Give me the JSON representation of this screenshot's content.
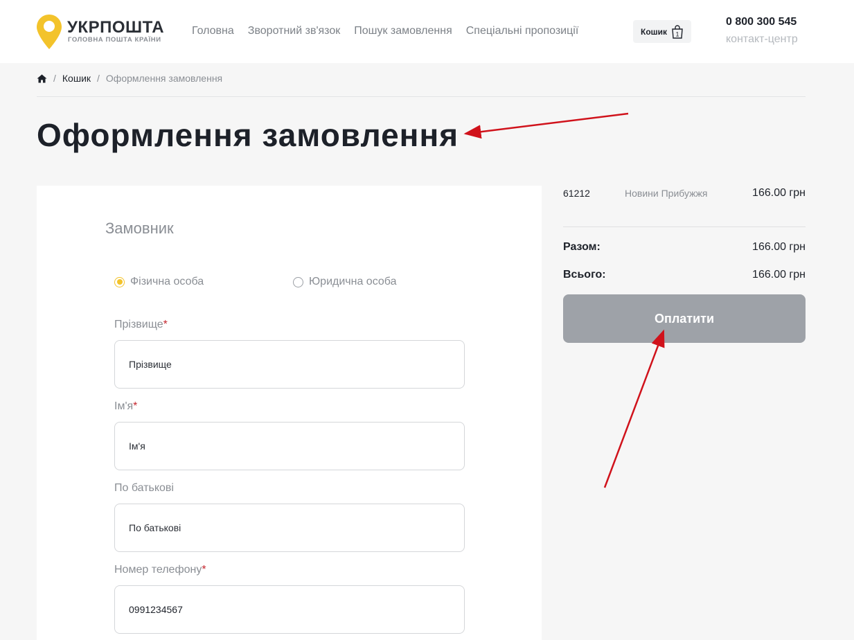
{
  "header": {
    "logo_name": "УКРПОШТА",
    "logo_sub": "ГОЛОВНА ПОШТА КРАЇНИ",
    "nav": [
      "Головна",
      "Зворотний зв'язок",
      "Пошук замовлення",
      "Спеціальні пропозиції"
    ],
    "cart_label": "Кошик",
    "cart_count": "1",
    "phone": "0 800 300 545",
    "phone_sub": "контакт-центр"
  },
  "breadcrumb": {
    "home_icon": "home-icon",
    "items": [
      "Кошик",
      "Оформлення замовлення"
    ]
  },
  "page_title": "Оформлення замовлення",
  "form": {
    "section_title": "Замовник",
    "radios": [
      {
        "label": "Фізична особа",
        "checked": true
      },
      {
        "label": "Юридична особа",
        "checked": false
      }
    ],
    "fields": [
      {
        "label": "Прізвище",
        "required": "*",
        "placeholder": "Прізвище",
        "value": ""
      },
      {
        "label": "Ім'я",
        "required": "*",
        "placeholder": "Ім'я",
        "value": ""
      },
      {
        "label": "По батькові",
        "required": "",
        "placeholder": "По батькові",
        "value": ""
      },
      {
        "label": "Номер телефону",
        "required": "*",
        "placeholder": "",
        "value": "0991234567"
      }
    ]
  },
  "summary": {
    "item_code": "61212",
    "item_name": "Новини Прибужжя",
    "item_price": "166.00 грн",
    "subtotal_label": "Разом:",
    "subtotal_value": "166.00 грн",
    "total_label": "Всього:",
    "total_value": "166.00 грн",
    "pay_label": "Оплатити"
  },
  "colors": {
    "accent": "#f3c32b",
    "annotation_arrow": "#d0121b",
    "pay_button": "#9ea2a8"
  }
}
